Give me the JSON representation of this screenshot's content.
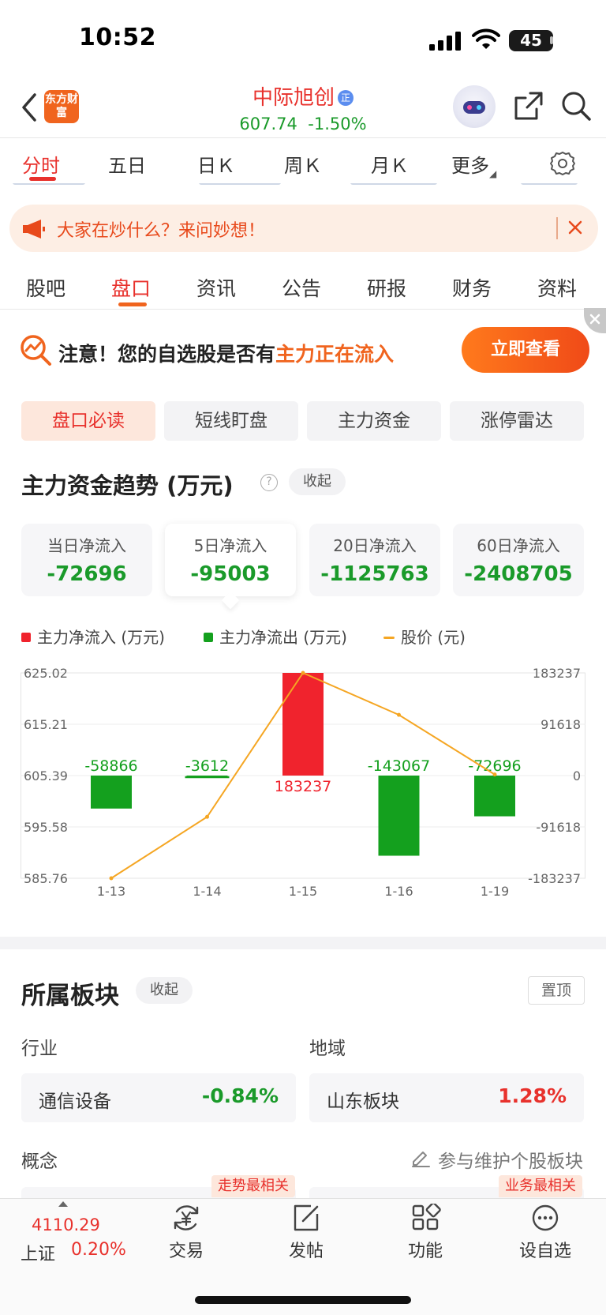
{
  "status_bar": {
    "time": "10:52",
    "battery": "45"
  },
  "header": {
    "logo_text": "东方财富",
    "stock_name": "中际旭创",
    "stock_badge": "正",
    "price": "607.74",
    "change_pct": "-1.50%"
  },
  "period_tabs": [
    "分时",
    "五日",
    "日Ｋ",
    "周Ｋ",
    "月Ｋ",
    "更多"
  ],
  "notice": {
    "text": "大家在炒什么？来问妙想！"
  },
  "section_tabs": [
    "股吧",
    "盘口",
    "资讯",
    "公告",
    "研报",
    "财务",
    "资料"
  ],
  "promo": {
    "prefix": "注意！您的自选股是否有",
    "highlight": "主力正在流入",
    "button": "立即查看"
  },
  "sub_tabs": [
    "盘口必读",
    "短线盯盘",
    "主力资金",
    "涨停雷达"
  ],
  "fund_trend": {
    "title": "主力资金趋势 (万元)",
    "collapse_label": "收起",
    "cards": [
      {
        "label": "当日净流入",
        "value": "-72696"
      },
      {
        "label": "5日净流入",
        "value": "-95003"
      },
      {
        "label": "20日净流入",
        "value": "-1125763"
      },
      {
        "label": "60日净流入",
        "value": "-2408705"
      }
    ],
    "legend": [
      "主力净流入 (万元)",
      "主力净流出 (万元)",
      "股价 (元)"
    ]
  },
  "colors": {
    "inflow": "#f0232d",
    "outflow": "#14a01e",
    "price_line": "#f5a623",
    "accent": "#f0641e"
  },
  "chart_data": {
    "type": "bar",
    "categories": [
      "1-13",
      "1-14",
      "1-15",
      "1-16",
      "1-19"
    ],
    "series": [
      {
        "name": "主力净流入/流出 (万元)",
        "values": [
          -58866,
          -3612,
          183237,
          -143067,
          -72696
        ]
      },
      {
        "name": "股价 (元)",
        "values": [
          585.76,
          597.5,
          625.02,
          617.0,
          605.6
        ]
      }
    ],
    "value_labels": [
      "-58866",
      "-3612",
      "183237",
      "-143067",
      "-72696"
    ],
    "y_left_ticks": [
      "625.02",
      "615.21",
      "605.39",
      "595.58",
      "585.76"
    ],
    "y_right_ticks": [
      "183237",
      "91618",
      "0",
      "-91618",
      "-183237"
    ],
    "ylim_left": [
      585.76,
      625.02
    ],
    "ylim_right": [
      -183237,
      183237
    ]
  },
  "sector": {
    "title": "所属板块",
    "collapse_label": "收起",
    "pin_label": "置顶",
    "industry_label": "行业",
    "region_label": "地域",
    "industry": {
      "name": "通信设备",
      "pct": "-0.84%"
    },
    "region": {
      "name": "山东板块",
      "pct": "1.28%"
    },
    "concept_label": "概念",
    "maintain_label": "参与维护个股板块",
    "tag_trend": "走势最相关",
    "tag_business": "业务最相关"
  },
  "bottom_bar": {
    "index_value": "4110.29",
    "index_name": "上证",
    "index_pct": "0.20%",
    "items": [
      "交易",
      "发帖",
      "功能",
      "设自选"
    ]
  }
}
